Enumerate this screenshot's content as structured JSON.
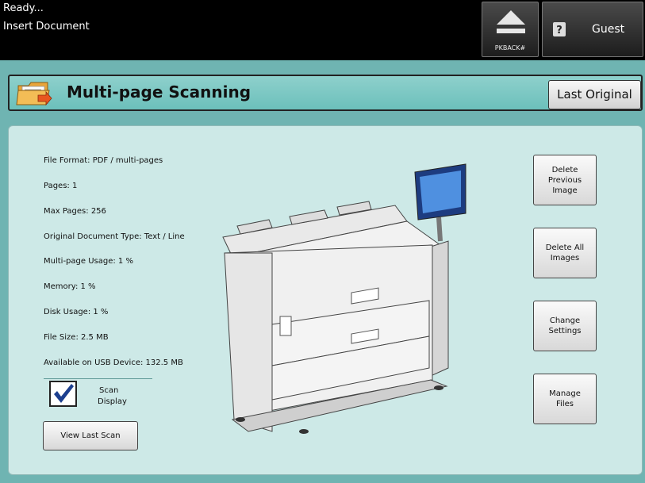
{
  "status": {
    "line1": "Ready...",
    "line2": "Insert Document"
  },
  "topbar": {
    "eject_label": "PKBACK#",
    "user_label": "Guest"
  },
  "header": {
    "title": "Multi-page Scanning",
    "last_original_label": "Last Original"
  },
  "info": {
    "file_format": "File Format:  PDF / multi-pages",
    "pages": "Pages:  1",
    "max_pages": "Max Pages:  256",
    "original_type": "Original Document Type:  Text / Line",
    "multipage_usage": "Multi-page Usage:  1 %",
    "memory": "Memory:  1 %",
    "disk_usage": "Disk Usage:  1 %",
    "file_size": "File Size:  2.5 MB",
    "usb_available": "Available on USB Device:  132.5 MB"
  },
  "scan_display": {
    "checked": true,
    "label_line1": "Scan",
    "label_line2": "Display"
  },
  "buttons": {
    "view_last_scan": "View Last Scan",
    "delete_previous_line1": "Delete",
    "delete_previous_line2": "Previous",
    "delete_previous_line3": "Image",
    "delete_all_line1": "Delete All",
    "delete_all_line2": "Images",
    "change_settings_line1": "Change",
    "change_settings_line2": "Settings",
    "manage_files_line1": "Manage",
    "manage_files_line2": "Files"
  },
  "icons": {
    "eject": "eject-icon",
    "user": "guest-user-icon",
    "folder": "folder-icon",
    "checkmark": "checkmark-icon",
    "device": "printer-scanner-illustration"
  },
  "colors": {
    "background": "#6fb4b2",
    "title_panel": "#7cc8c4",
    "main_panel": "#cde9e7",
    "topbar": "#000000",
    "checkmark": "#1c3f8f"
  }
}
